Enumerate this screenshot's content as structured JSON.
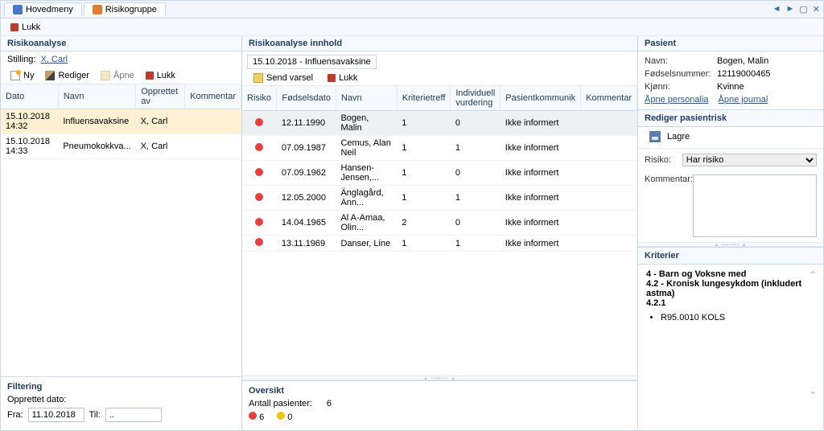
{
  "tabs": {
    "hovedmeny": "Hovedmeny",
    "risikogruppe": "Risikogruppe"
  },
  "wincontrols": [
    "◄",
    "►",
    "▢",
    "✕"
  ],
  "global_toolbar": {
    "lukk": "Lukk"
  },
  "left": {
    "title": "Risikoanalyse",
    "stilling_label": "Stilling:",
    "stilling_value": "X, Carl",
    "toolbar": {
      "ny": "Ny",
      "rediger": "Rediger",
      "apne": "Åpne",
      "lukk": "Lukk"
    },
    "cols": {
      "dato": "Dato",
      "navn": "Navn",
      "opprettet": "Opprettet av",
      "kommentar": "Kommentar"
    },
    "rows": [
      {
        "dato": "15.10.2018 14:32",
        "navn": "Influensavaksine",
        "opprettet": "X, Carl",
        "kommentar": ""
      },
      {
        "dato": "15.10.2018 14:33",
        "navn": "Pneumokokkva...",
        "opprettet": "X, Carl",
        "kommentar": ""
      }
    ],
    "filtering": {
      "title": "Filtering",
      "opprettet_label": "Opprettet dato:",
      "fra_label": "Fra:",
      "fra_value": "11.10.2018",
      "til_label": "Til:",
      "til_value": ".."
    }
  },
  "mid": {
    "title": "Risikoanalyse innhold",
    "subtitle": "15.10.2018 - Influensavaksine",
    "toolbar": {
      "send": "Send varsel",
      "lukk": "Lukk"
    },
    "cols": {
      "risiko": "Risiko",
      "fodselsdato": "Fødselsdato",
      "navn": "Navn",
      "kriterietreff": "Kriterietreff",
      "individuell": "Individuell vurdering",
      "pasientkomm": "Pasientkommunik",
      "kommentar": "Kommentar"
    },
    "rows": [
      {
        "risiko": "red",
        "fd": "12.11.1990",
        "navn": "Bogen, Malin",
        "kt": "1",
        "iv": "0",
        "pk": "Ikke informert"
      },
      {
        "risiko": "red",
        "fd": "07.09.1987",
        "navn": "Cemus, Alan Neil",
        "kt": "1",
        "iv": "1",
        "pk": "Ikke informert"
      },
      {
        "risiko": "red",
        "fd": "07.09.1962",
        "navn": "Hansen-Jensen,...",
        "kt": "1",
        "iv": "0",
        "pk": "Ikke informert"
      },
      {
        "risiko": "red",
        "fd": "12.05.2000",
        "navn": "Änglagård, Ann...",
        "kt": "1",
        "iv": "1",
        "pk": "Ikke informert"
      },
      {
        "risiko": "red",
        "fd": "14.04.1965",
        "navn": "Al A-Amaa, Olin...",
        "kt": "2",
        "iv": "0",
        "pk": "Ikke informert"
      },
      {
        "risiko": "red",
        "fd": "13.11.1969",
        "navn": "Danser, Line",
        "kt": "1",
        "iv": "1",
        "pk": "Ikke informert"
      }
    ],
    "oversikt": {
      "title": "Oversikt",
      "antall_label": "Antall pasienter:",
      "antall_value": "6",
      "red_count": "6",
      "yellow_count": "0"
    }
  },
  "right": {
    "pasient": {
      "title": "Pasient",
      "navn_label": "Navn:",
      "navn": "Bogen, Malin",
      "fnr_label": "Fødselsnummer:",
      "fnr": "12119000465",
      "kjonn_label": "Kjønn:",
      "kjonn": "Kvinne",
      "apne_personalia": "Åpne personalia",
      "apne_journal": "Åpne journal"
    },
    "rediger": {
      "title": "Rediger pasientrisk",
      "lagre": "Lagre",
      "risiko_label": "Risiko:",
      "risiko_value": "Har risiko",
      "kommentar_label": "Kommentar:"
    },
    "kriterier": {
      "title": "Kriterier",
      "line1": "4 - Barn og Voksne med",
      "line2": "4.2 - Kronisk lungesykdom (inkludert astma)",
      "line3": "4.2.1",
      "bullet": "R95.0010 KOLS"
    }
  }
}
